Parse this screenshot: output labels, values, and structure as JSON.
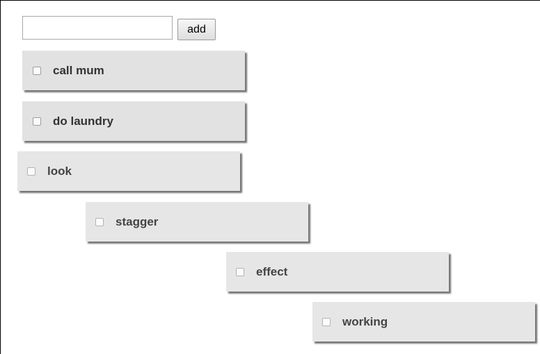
{
  "form": {
    "input_value": "",
    "input_placeholder": "",
    "add_label": "add"
  },
  "todos": [
    {
      "label": "call mum",
      "checked": false
    },
    {
      "label": "do laundry",
      "checked": false
    },
    {
      "label": "look",
      "checked": false
    },
    {
      "label": "stagger",
      "checked": false
    },
    {
      "label": "effect",
      "checked": false
    },
    {
      "label": "working",
      "checked": false
    }
  ]
}
